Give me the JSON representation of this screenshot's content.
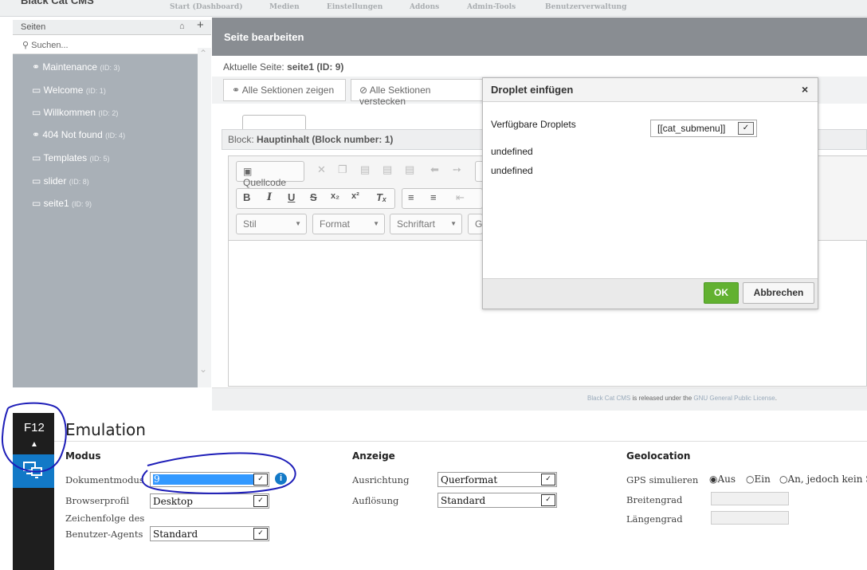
{
  "app": {
    "logo": "Black Cat CMS"
  },
  "nav": {
    "items": [
      "Start (Dashboard)",
      "Medien",
      "Einstellungen",
      "Addons",
      "Admin-Tools",
      "Benutzerverwaltung"
    ]
  },
  "sidebar": {
    "title": "Seiten",
    "search_placeholder": "Suchen...",
    "pages": [
      {
        "icon": "eye-icon",
        "label": "Maintenance",
        "id": "(ID: 3)"
      },
      {
        "icon": "monitor-icon",
        "label": "Welcome",
        "id": "(ID: 1)"
      },
      {
        "icon": "monitor-icon",
        "label": "Willkommen",
        "id": "(ID: 2)"
      },
      {
        "icon": "eye-icon",
        "label": "404 Not found",
        "id": "(ID: 4)"
      },
      {
        "icon": "monitor-icon",
        "label": "Templates",
        "id": "(ID: 5)"
      },
      {
        "icon": "monitor-icon",
        "label": "slider",
        "id": "(ID: 8)"
      },
      {
        "icon": "monitor-icon",
        "label": "seite1",
        "id": "(ID: 9)"
      }
    ]
  },
  "main": {
    "title": "Seite bearbeiten",
    "current_label": "Aktuelle Seite:",
    "current_value": "seite1 (ID: 9)",
    "show_all": "Alle Sektionen zeigen",
    "hide_all": "Alle Sektionen verstecken",
    "block_label": "Block:",
    "block_value": "Hauptinhalt (Block number: 1)"
  },
  "editor": {
    "source": "Quellcode",
    "style": "Stil",
    "format": "Format",
    "font": "Schriftart",
    "size_stub": "G"
  },
  "footer": {
    "brand": "Black Cat CMS",
    "text": "is released under the",
    "license": "GNU General Public License",
    "end": "."
  },
  "dialog": {
    "title": "Droplet einfügen",
    "label": "Verfügbare Droplets",
    "selected": "[[cat_submenu]]",
    "line1": "undefined",
    "line2": "undefined",
    "ok": "OK",
    "cancel": "Abbrechen"
  },
  "f12": {
    "key": "F12",
    "panel_title": "Emulation",
    "modus": {
      "heading": "Modus",
      "doc_mode_label": "Dokumentmodus",
      "doc_mode_value": "9",
      "browser_label": "Browserprofil",
      "browser_value": "Desktop",
      "ua_label_1": "Zeichenfolge des",
      "ua_label_2": "Benutzer-Agents",
      "ua_value": "Standard"
    },
    "anzeige": {
      "heading": "Anzeige",
      "orient_label": "Ausrichtung",
      "orient_value": "Querformat",
      "res_label": "Auflösung",
      "res_value": "Standard"
    },
    "geo": {
      "heading": "Geolocation",
      "gps_label": "GPS simulieren",
      "opt_off": "Aus",
      "opt_on": "Ein",
      "opt_partial": "An, jedoch kein Si",
      "lat_label": "Breitengrad",
      "lon_label": "Längengrad"
    }
  },
  "colors": {
    "accent_green": "#62b131",
    "f12_blue": "#1279c7",
    "annotation": "#1d1db8"
  }
}
